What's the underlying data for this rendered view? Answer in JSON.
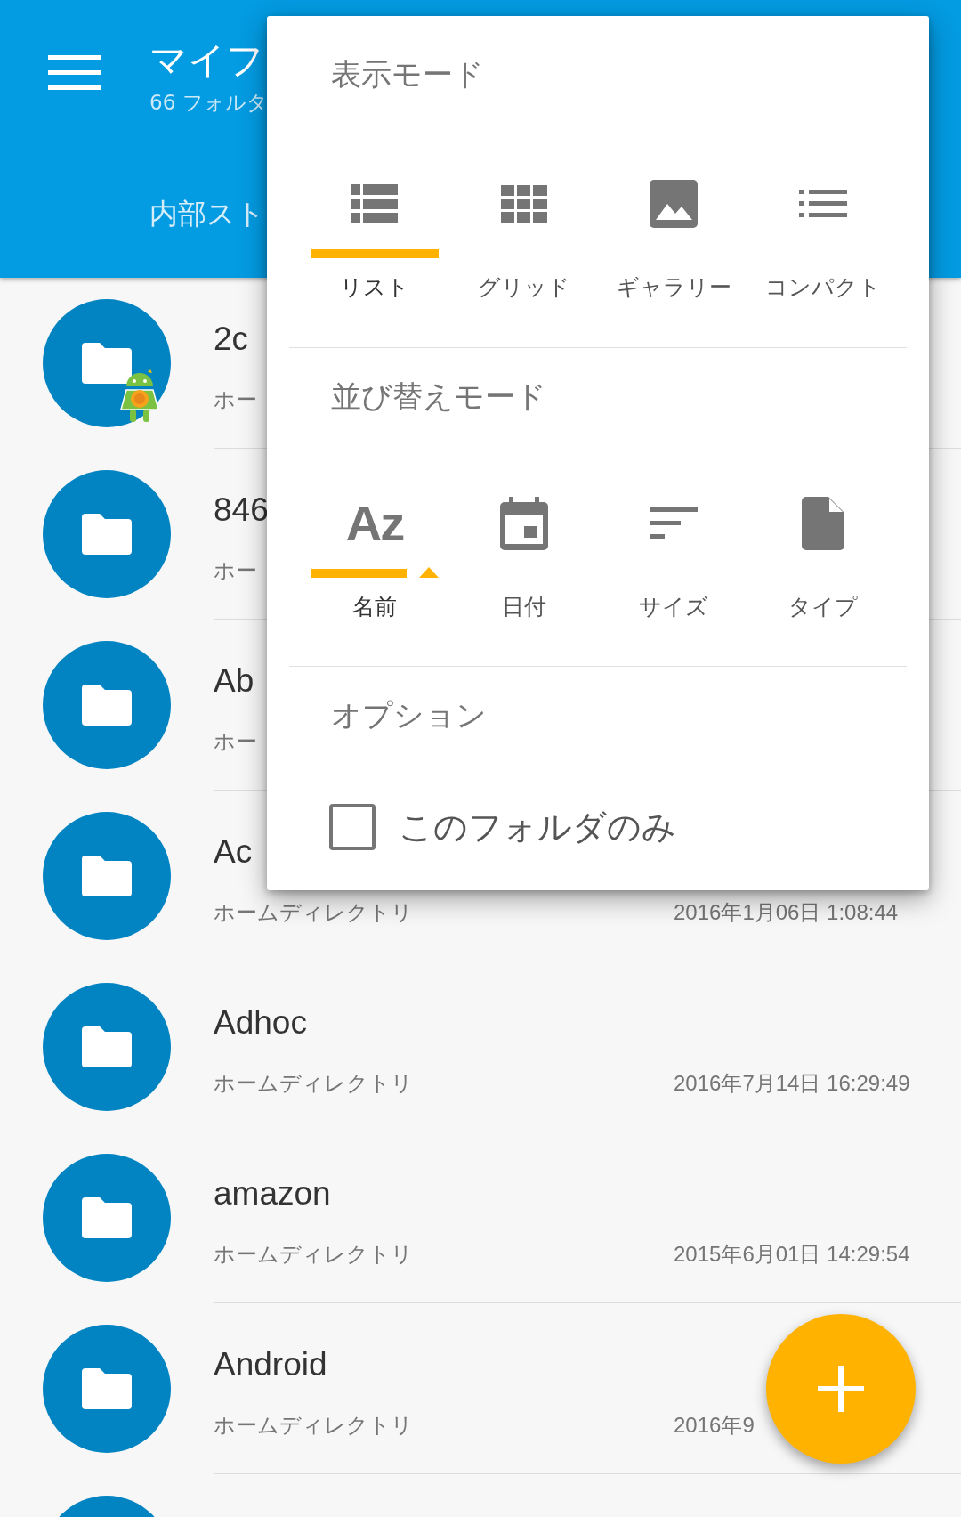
{
  "app_bar": {
    "title": "マイフ",
    "subtitle": "66 フォルタ",
    "tab": "内部スト"
  },
  "files": [
    {
      "kind": "app-folder",
      "name": "2c",
      "location": "ホー"
    },
    {
      "kind": "folder",
      "name": "846",
      "location": "ホー"
    },
    {
      "kind": "folder",
      "name": "Ab",
      "location": "ホー"
    },
    {
      "kind": "folder",
      "name": "Ac",
      "location": "ホームディレクトリ",
      "modified": "2016年1月06日 1:08:44"
    },
    {
      "kind": "folder",
      "name": "Adhoc",
      "location": "ホームディレクトリ",
      "modified": "2016年7月14日 16:29:49"
    },
    {
      "kind": "folder",
      "name": "amazon",
      "location": "ホームディレクトリ",
      "modified": "2015年6月01日 14:29:54"
    },
    {
      "kind": "folder",
      "name": "Android",
      "location": "ホームディレクトリ",
      "modified": "2016年9"
    },
    {
      "kind": "folder"
    }
  ],
  "popup": {
    "view_mode": {
      "title": "表示モード",
      "options": [
        {
          "kind": "list",
          "label": "リスト",
          "selected": true
        },
        {
          "kind": "grid",
          "label": "グリッド",
          "selected": false
        },
        {
          "kind": "gallery",
          "label": "ギャラリー",
          "selected": false
        },
        {
          "kind": "compact",
          "label": "コンパクト",
          "selected": false
        }
      ]
    },
    "sort_mode": {
      "title": "並び替えモード",
      "options": [
        {
          "kind": "name",
          "icon_text": "Az",
          "label": "名前",
          "selected": true,
          "ascending": true
        },
        {
          "kind": "date",
          "label": "日付",
          "selected": false
        },
        {
          "kind": "size",
          "label": "サイズ",
          "selected": false
        },
        {
          "kind": "type",
          "label": "タイプ",
          "selected": false
        }
      ]
    },
    "options": {
      "title": "オプション",
      "items": [
        {
          "label": "このフォルダのみ",
          "checked": false
        }
      ]
    }
  }
}
